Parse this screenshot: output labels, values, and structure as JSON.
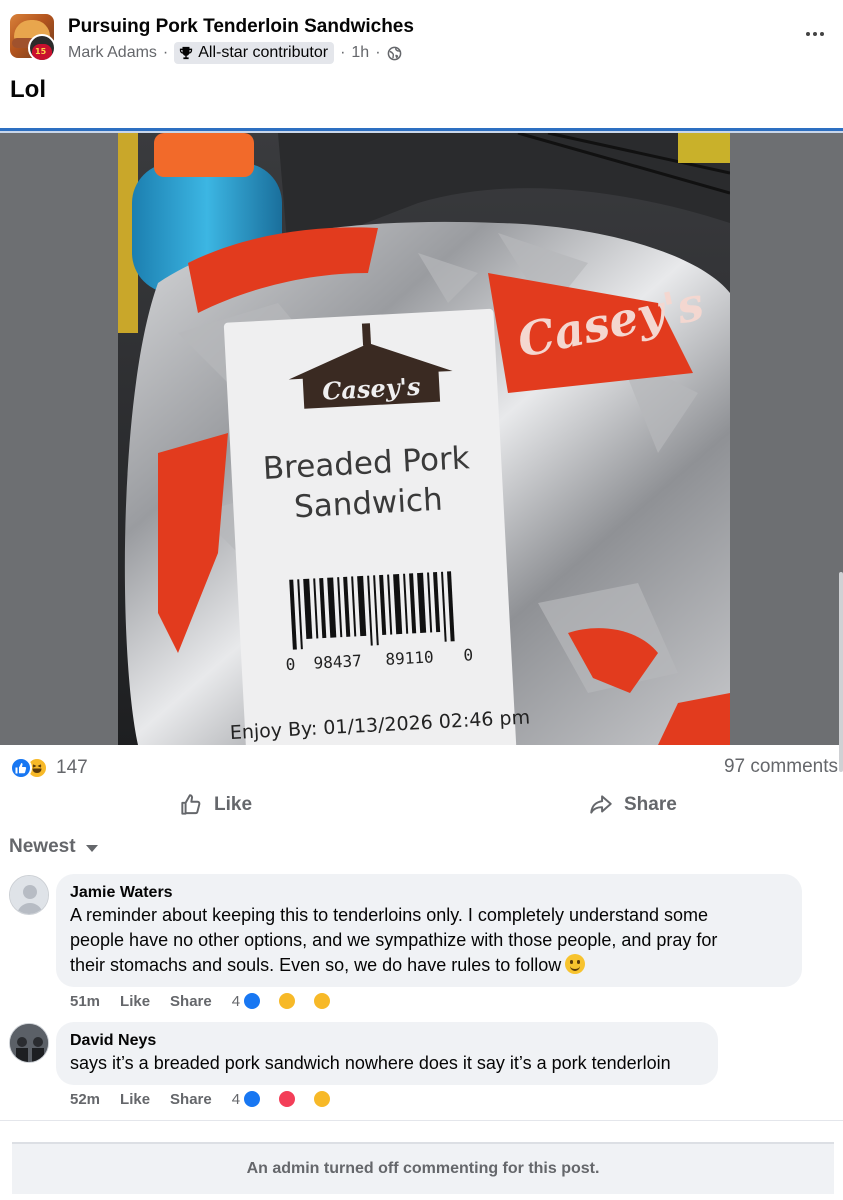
{
  "post": {
    "group_name": "Pursuing Pork Tenderloin Sandwiches",
    "author": "Mark Adams",
    "badge": "All-star contributor",
    "time": "1h",
    "text": "Lol",
    "avatar_number": "15"
  },
  "photo": {
    "brand": "Casey's",
    "label_line1": "Breaded Pork",
    "label_line2": "Sandwich",
    "barcode_left": "0",
    "barcode_mid1": "98437",
    "barcode_mid2": "89110",
    "barcode_right": "0",
    "enjoy_by": "Enjoy By: 01/13/2026 02:46 pm"
  },
  "stats": {
    "reaction_count": "147",
    "comments": "97 comments"
  },
  "actions": {
    "like": "Like",
    "share": "Share"
  },
  "sort": {
    "label": "Newest"
  },
  "comments": [
    {
      "name": "Jamie Waters",
      "lines": [
        "A reminder about keeping this to tenderloins only. I completely understand some",
        "people have no other options, and we sympathize with those people, and pray for",
        "their stomachs and souls. Even so, we do have rules to follow"
      ],
      "time": "51m",
      "like": "Like",
      "share": "Share",
      "reaction_count": "4"
    },
    {
      "name": "David Neys",
      "lines": [
        "says it’s a breaded pork sandwich nowhere does it say it’s a pork tenderloin"
      ],
      "time": "52m",
      "like": "Like",
      "share": "Share",
      "reaction_count": "4"
    }
  ],
  "notice": "An admin turned off commenting for this post.",
  "colors": {
    "facebook_blue": "#1877f2",
    "muted_text": "#65676b",
    "bubble": "#f0f2f5",
    "casey_red": "#e23b1e"
  },
  "icons": [
    "trophy-icon",
    "globe-icon",
    "more-icon",
    "like-reaction-icon",
    "haha-reaction-icon",
    "love-reaction-icon",
    "care-reaction-icon",
    "sad-reaction-icon",
    "thumbs-up-icon",
    "share-arrow-icon",
    "caret-down-icon",
    "smile-emoji-icon"
  ]
}
